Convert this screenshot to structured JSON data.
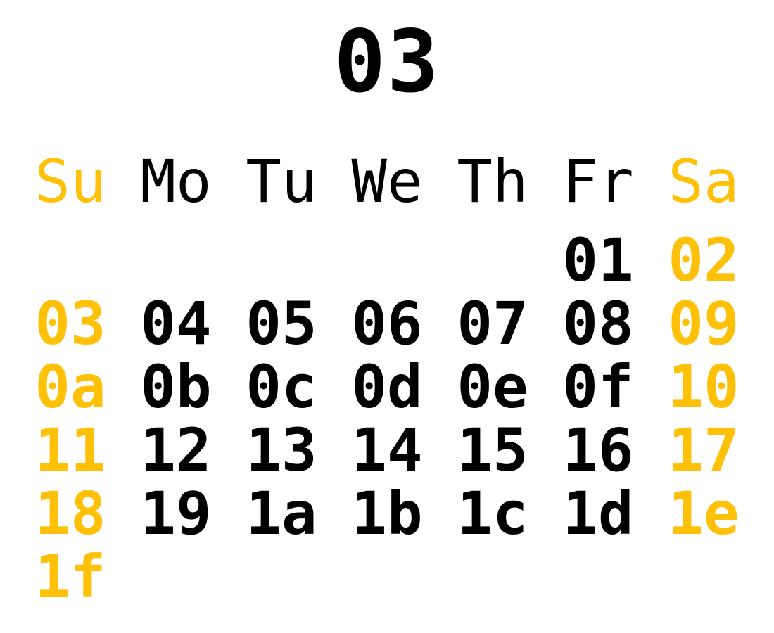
{
  "month": "03",
  "colors": {
    "weekend": "#FFC107",
    "weekday": "#000000",
    "background": "#FFFFFF"
  },
  "weekdays": [
    "Su",
    "Mo",
    "Tu",
    "We",
    "Th",
    "Fr",
    "Sa"
  ],
  "weeks": [
    [
      "",
      "",
      "",
      "",
      "",
      "01",
      "02"
    ],
    [
      "03",
      "04",
      "05",
      "06",
      "07",
      "08",
      "09"
    ],
    [
      "0a",
      "0b",
      "0c",
      "0d",
      "0e",
      "0f",
      "10"
    ],
    [
      "11",
      "12",
      "13",
      "14",
      "15",
      "16",
      "17"
    ],
    [
      "18",
      "19",
      "1a",
      "1b",
      "1c",
      "1d",
      "1e"
    ],
    [
      "1f",
      "",
      "",
      "",
      "",
      "",
      ""
    ]
  ]
}
